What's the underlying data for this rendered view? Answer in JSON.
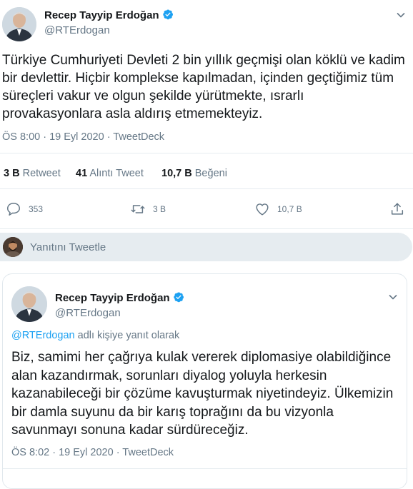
{
  "main_tweet": {
    "author_name": "Recep Tayyip Erdoğan",
    "author_handle": "@RTErdogan",
    "text": "Türkiye Cumhuriyeti Devleti 2 bin yıllık geçmişi olan köklü ve kadim bir devlettir. Hiçbir komplekse kapılmadan, içinden geçtiğimiz tüm süreçleri vakur ve olgun şekilde yürütmekte, ısrarlı provakasyonlara asla aldırış etmemekteyiz.",
    "timestamp": "ÖS 8:00 · 19 Eyl 2020 · TweetDeck",
    "stats": {
      "retweets_count": "3 B",
      "retweets_label": "Retweet",
      "quotes_count": "41",
      "quotes_label": "Alıntı Tweet",
      "likes_count": "10,7 B",
      "likes_label": "Beğeni"
    },
    "actions": {
      "reply_count": "353",
      "retweet_count": "3 B",
      "like_count": "10,7 B"
    }
  },
  "reply_composer": {
    "placeholder": "Yanıtını Tweetle"
  },
  "reply_tweet": {
    "author_name": "Recep Tayyip Erdoğan",
    "author_handle": "@RTErdogan",
    "replying_to_handle": "@RTErdogan",
    "replying_to_suffix": "adlı kişiye yanıt olarak",
    "text": "Biz, samimi her çağrıya kulak vererek diplomasiye olabildiğince alan kazandırmak, sorunları diyalog yoluyla herkesin kazanabileceği bir çözüme kavuşturmak niyetindeyiz. Ülkemizin bir damla suyunu da bir karış toprağını da bu vizyonla savunmayı sonuna kadar sürdüreceğiz.",
    "timestamp": "ÖS 8:02 · 19 Eyl 2020 · TweetDeck"
  },
  "colors": {
    "accent": "#1da1f2",
    "muted": "#657786",
    "divider": "#e6ecf0",
    "composer_bg": "#e6ecf0"
  }
}
